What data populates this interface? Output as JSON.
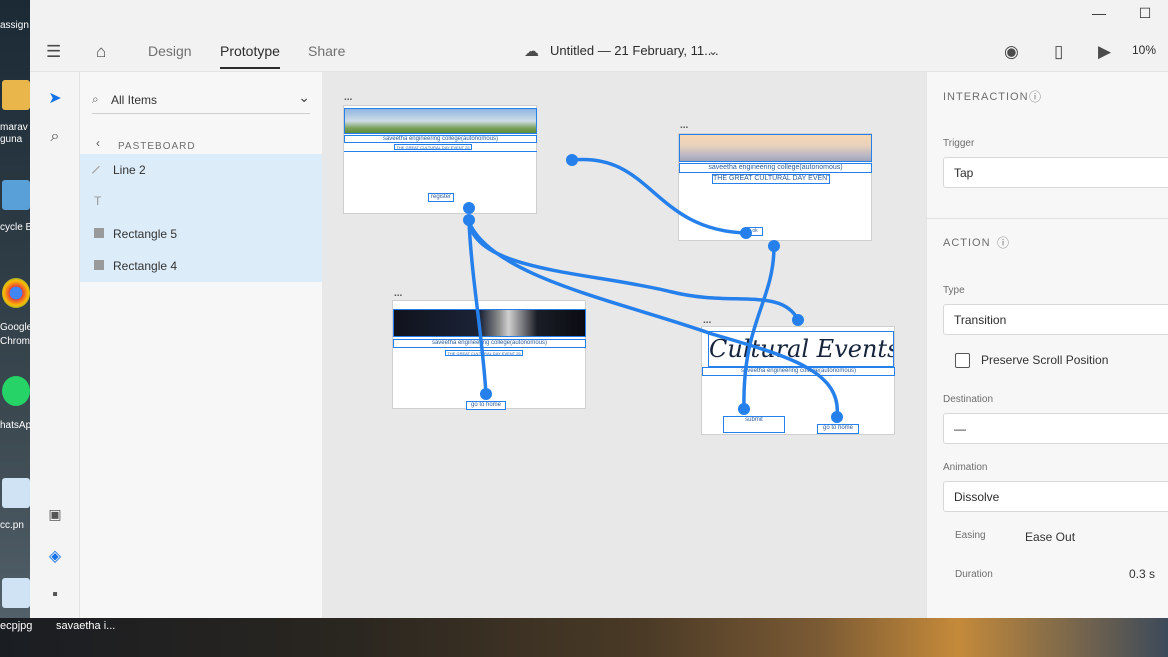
{
  "desktop": {
    "left_labels": [
      "assign",
      "marav",
      "guna",
      "cycle B",
      "Google",
      "Chrom",
      "hatsAp",
      "cc.pn",
      "cp.jpg"
    ],
    "bottom_labels": [
      "savaetha i...",
      "ecpjpg"
    ]
  },
  "titlebar": {
    "minimize": "—",
    "maximize": "☐"
  },
  "appbar": {
    "tabs": [
      "Design",
      "Prototype",
      "Share"
    ],
    "document_title": "Untitled — 21 February, 11....",
    "zoom": "10%"
  },
  "layers": {
    "search_placeholder": "All Items",
    "section": "PASTEBOARD",
    "items": [
      {
        "label": "Line 2",
        "icon": "line-icon"
      },
      {
        "label": "",
        "icon": "text-icon"
      },
      {
        "label": "Rectangle 5",
        "icon": "rectangle-icon"
      },
      {
        "label": "Rectangle 4",
        "icon": "rectangle-icon"
      }
    ]
  },
  "canvas": {
    "artboards": [
      {
        "label": "...",
        "texts": [
          "saveetha engineering college(autonomous)",
          "THE GREAT CULTURAL DAY EVENT 25",
          "register"
        ]
      },
      {
        "label": "...",
        "texts": [
          "saveetha engineering college(autonomous)",
          "THE GREAT CULTURAL DAY EVENT",
          "ok"
        ]
      },
      {
        "label": "...",
        "texts": [
          "saveetha engineering college(autonomous)",
          "THE GREAT CULTURAL DAY EVENT 25",
          "go to home"
        ]
      },
      {
        "label": "...",
        "texts": [
          "Cultural Events",
          "saveetha engineering college(autonomous)",
          "submit",
          "go to home"
        ]
      }
    ]
  },
  "inspector": {
    "interaction_title": "INTERACTION",
    "trigger_label": "Trigger",
    "trigger_value": "Tap",
    "action_title": "ACTION",
    "type_label": "Type",
    "type_value": "Transition",
    "preserve_scroll": "Preserve Scroll Position",
    "destination_label": "Destination",
    "destination_value": "—",
    "animation_label": "Animation",
    "animation_value": "Dissolve",
    "easing_label": "Easing",
    "easing_value": "Ease Out",
    "duration_label": "Duration",
    "duration_value": "0.3 s"
  },
  "colors": {
    "wire": "#2680eb",
    "accent": "#1473e6",
    "selection": "#dcecf8"
  }
}
